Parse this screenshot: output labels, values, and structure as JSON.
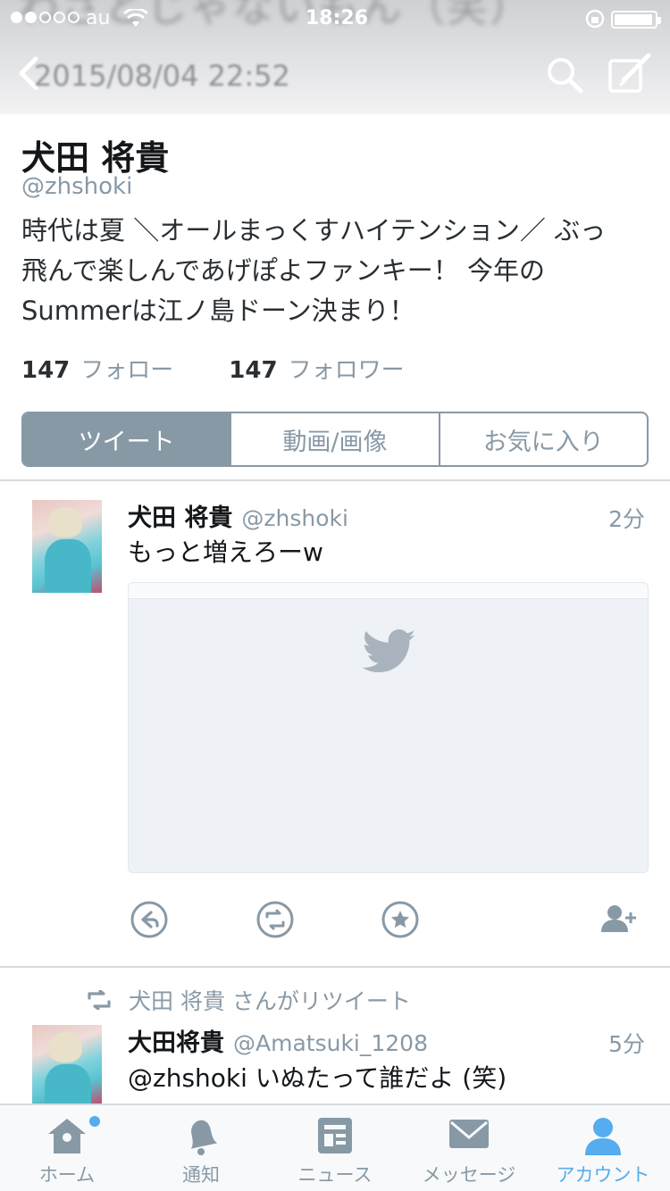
{
  "status_bar": {
    "carrier": "au",
    "time": "18:26",
    "battery_level": 0.95
  },
  "header": {
    "banner_text": "わざとじゃないもん（笑）",
    "date": "2015/08/04 22:52"
  },
  "profile": {
    "name": "犬田 将貴",
    "handle": "@zhshoki",
    "bio_lines": [
      "時代は夏 ＼オールまっくすハイテンション／ ぶっ",
      "飛んで楽しんであげぽよファンキー！ 今年の",
      "Summerは江ノ島ドーン決まり！"
    ],
    "following_count": "147",
    "following_label": "フォロー",
    "followers_count": "147",
    "followers_label": "フォロワー"
  },
  "segments": [
    {
      "label": "ツイート",
      "active": true
    },
    {
      "label": "動画/画像",
      "active": false
    },
    {
      "label": "お気に入り",
      "active": false
    }
  ],
  "tweets": [
    {
      "name": "犬田 将貴",
      "handle": "@zhshoki",
      "time": "2分",
      "text": "もっと増えろーw"
    },
    {
      "retweet_note": "犬田 将貴 さんがリツイート",
      "name": "大田将貴",
      "handle": "@Amatsuki_1208",
      "time": "5分",
      "text": "@zhshoki いぬたって誰だよ (笑)"
    }
  ],
  "tabbar": [
    {
      "label": "ホーム",
      "icon": "home-icon",
      "active": false
    },
    {
      "label": "通知",
      "icon": "bell-icon",
      "active": false
    },
    {
      "label": "ニュース",
      "icon": "news-icon",
      "active": false
    },
    {
      "label": "メッセージ",
      "icon": "envelope-icon",
      "active": false
    },
    {
      "label": "アカウント",
      "icon": "person-icon",
      "active": true
    }
  ],
  "colors": {
    "accent": "#55acee",
    "muted": "#8899a6",
    "text": "#14171a"
  }
}
